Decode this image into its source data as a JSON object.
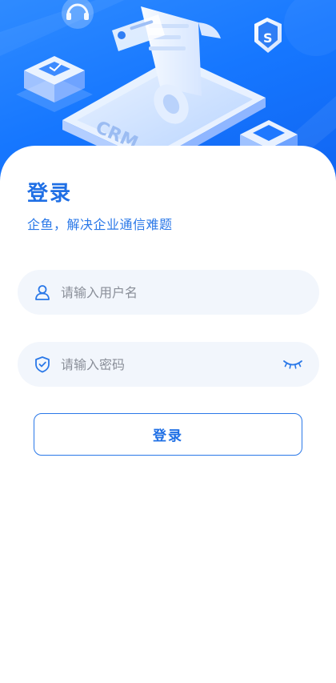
{
  "hero": {
    "illustration_label": "CRM",
    "shield_letter": "S"
  },
  "login": {
    "title": "登录",
    "subtitle": "企鱼，解决企业通信难题",
    "username_placeholder": "请输入用户名",
    "password_placeholder": "请输入密码",
    "button_label": "登录"
  },
  "icons": {
    "username": "user-icon",
    "password": "shield-check-icon",
    "toggle_password": "eye-closed-icon"
  },
  "colors": {
    "accent": "#1f6fe5",
    "hero_bg": "#1677ff",
    "field_bg": "#f2f6fc",
    "placeholder": "#8a8f99"
  }
}
